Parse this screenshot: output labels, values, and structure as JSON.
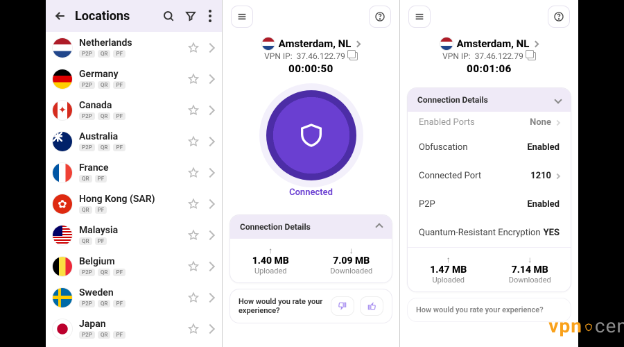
{
  "locations": {
    "title": "Locations",
    "items": [
      {
        "name": "Netherlands",
        "tags": [
          "P2P",
          "QR",
          "PF"
        ],
        "flag": "flag-nl"
      },
      {
        "name": "Germany",
        "tags": [
          "P2P",
          "QR",
          "PF"
        ],
        "flag": "flag-de"
      },
      {
        "name": "Canada",
        "tags": [
          "P2P",
          "QR",
          "PF"
        ],
        "flag": "flag-ca"
      },
      {
        "name": "Australia",
        "tags": [
          "P2P",
          "QR",
          "PF"
        ],
        "flag": "flag-au"
      },
      {
        "name": "France",
        "tags": [
          "QR",
          "PF"
        ],
        "flag": "flag-fr"
      },
      {
        "name": "Hong Kong (SAR)",
        "tags": [
          "QR",
          "PF"
        ],
        "flag": "flag-hk"
      },
      {
        "name": "Malaysia",
        "tags": [
          "QR",
          "PF"
        ],
        "flag": "flag-my"
      },
      {
        "name": "Belgium",
        "tags": [
          "P2P",
          "QR",
          "PF"
        ],
        "flag": "flag-be"
      },
      {
        "name": "Sweden",
        "tags": [
          "P2P",
          "QR",
          "PF"
        ],
        "flag": "flag-se"
      },
      {
        "name": "Japan",
        "tags": [
          "P2P",
          "QR",
          "PF"
        ],
        "flag": "flag-jp"
      }
    ]
  },
  "screen2": {
    "server_name": "Amsterdam, NL",
    "ip_label": "VPN IP:",
    "ip_value": "37.46.122.79",
    "timer": "00:00:50",
    "status": "Connected",
    "details_title": "Connection Details",
    "uploaded_value": "1.40 MB",
    "uploaded_label": "Uploaded",
    "downloaded_value": "7.09 MB",
    "downloaded_label": "Downloaded",
    "rate_question": "How would you rate your experience?"
  },
  "screen3": {
    "server_name": "Amsterdam, NL",
    "ip_label": "VPN IP:",
    "ip_value": "37.46.122.79",
    "timer": "00:01:06",
    "details_title": "Connection Details",
    "rows": {
      "enabled_ports_k": "Enabled Ports",
      "enabled_ports_v": "None",
      "obfuscation_k": "Obfuscation",
      "obfuscation_v": "Enabled",
      "connected_port_k": "Connected Port",
      "connected_port_v": "1210",
      "p2p_k": "P2P",
      "p2p_v": "Enabled",
      "qre_k": "Quantum-Resistant Encryption",
      "qre_v": "YES"
    },
    "uploaded_value": "1.47 MB",
    "uploaded_label": "Uploaded",
    "downloaded_value": "7.14 MB",
    "downloaded_label": "Downloaded",
    "rate_question": "How would you rate your experience?"
  },
  "watermark": {
    "brand_v": "v",
    "brand_p": "p",
    "brand_n": "n",
    "brand_rest": "central"
  }
}
